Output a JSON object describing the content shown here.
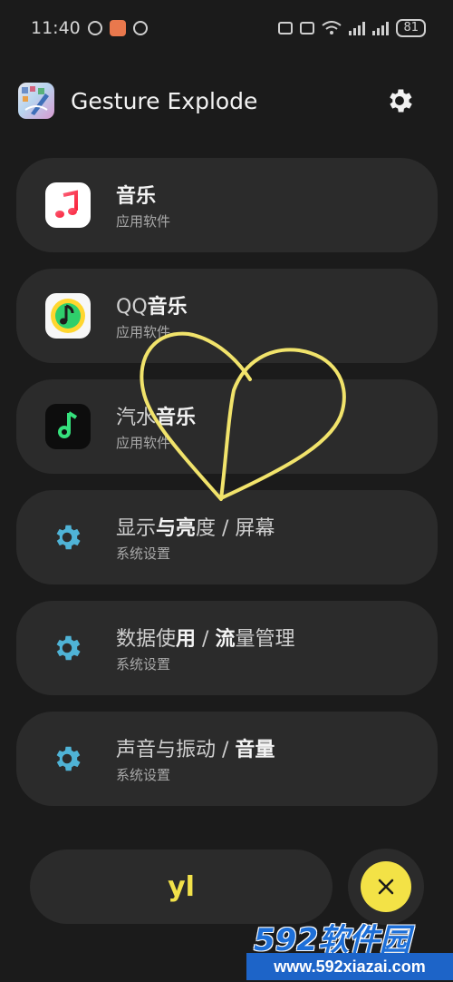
{
  "status_bar": {
    "time": "11:40",
    "battery": "81"
  },
  "header": {
    "title": "Gesture Explode",
    "settings_icon": "gear-icon"
  },
  "colors": {
    "background": "#1b1b1b",
    "card": "#2b2b2b",
    "accent": "#f3e246",
    "gear": "#4fb3d6",
    "input_text": "#f2e24a"
  },
  "items": [
    {
      "title_parts": [
        "",
        "音乐"
      ],
      "subtitle": "应用软件",
      "icon": "music-app-icon"
    },
    {
      "title_parts": [
        "QQ",
        "音乐"
      ],
      "subtitle": "应用软件",
      "icon": "qq-music-icon"
    },
    {
      "title_parts": [
        "汽水",
        "音乐"
      ],
      "subtitle": "应用软件",
      "icon": "soda-music-icon"
    },
    {
      "title_parts": [
        "显示",
        "与亮",
        "度 / 屏幕"
      ],
      "subtitle": "系统设置",
      "icon": "gear-icon"
    },
    {
      "title_parts": [
        "数据使",
        "用",
        " / ",
        "流",
        "量管理"
      ],
      "subtitle": "系统设置",
      "icon": "gear-icon"
    },
    {
      "title_parts": [
        "声音与振动 / ",
        "音量"
      ],
      "subtitle": "系统设置",
      "icon": "gear-icon"
    }
  ],
  "gesture_input": {
    "text": "yl"
  },
  "close_button": {
    "icon": "close-icon"
  },
  "watermark": {
    "brand": "592软件园",
    "url": "www.592xiazai.com"
  }
}
